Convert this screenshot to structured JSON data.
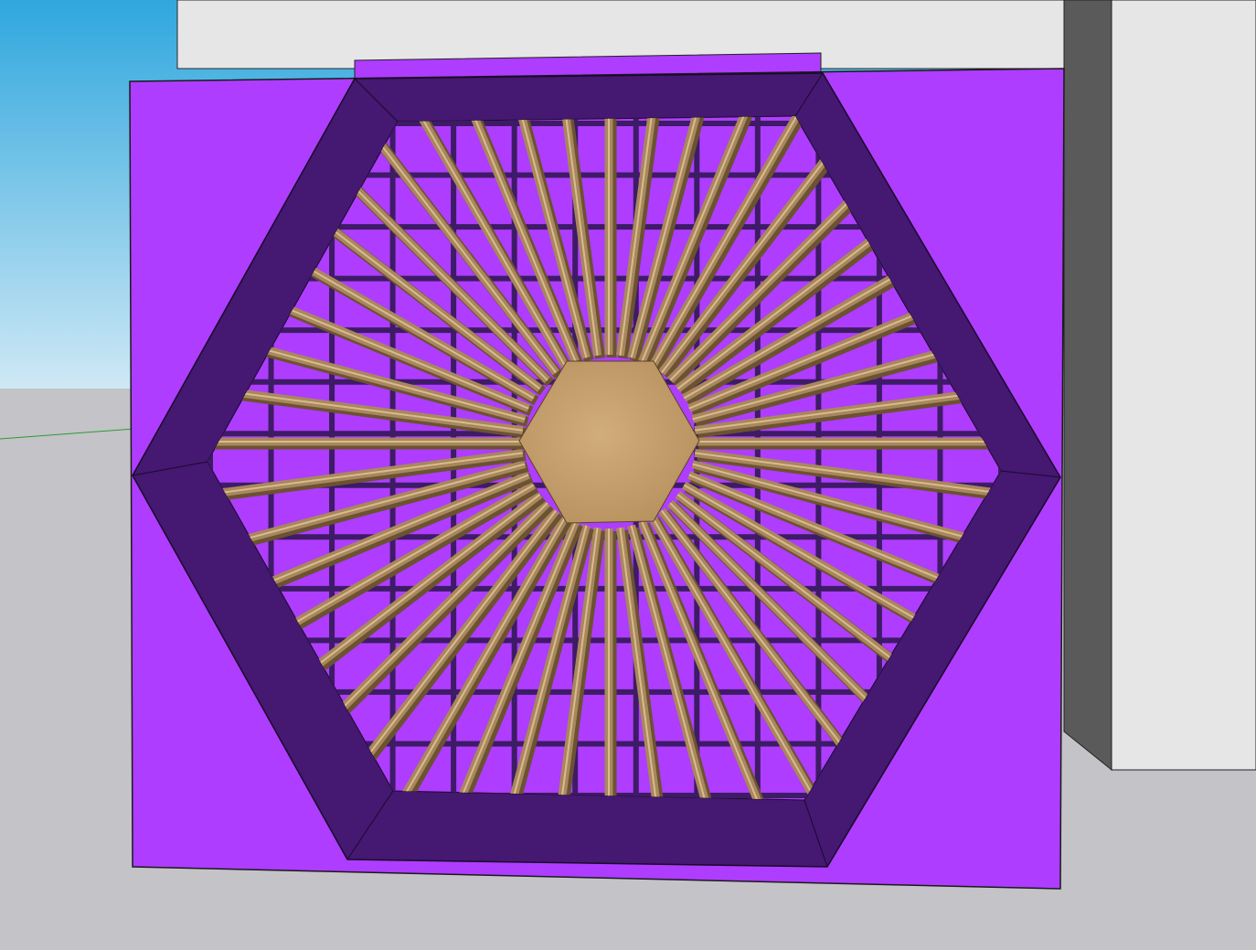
{
  "scene": {
    "sky_top": "#2fa7de",
    "sky_bottom": "#cfe8f5",
    "ground": "#c3c3c8",
    "wall": "#e6e6e6",
    "wall_side": "#5a5a5a",
    "panel": "#ae3dff",
    "frame": "#451872",
    "hub": "#c9a170",
    "spoke": "#a8875e",
    "spoke_dark": "#6b5231",
    "lattice": "#3e1b66",
    "spoke_count": 48,
    "lattice_lines": 13
  }
}
